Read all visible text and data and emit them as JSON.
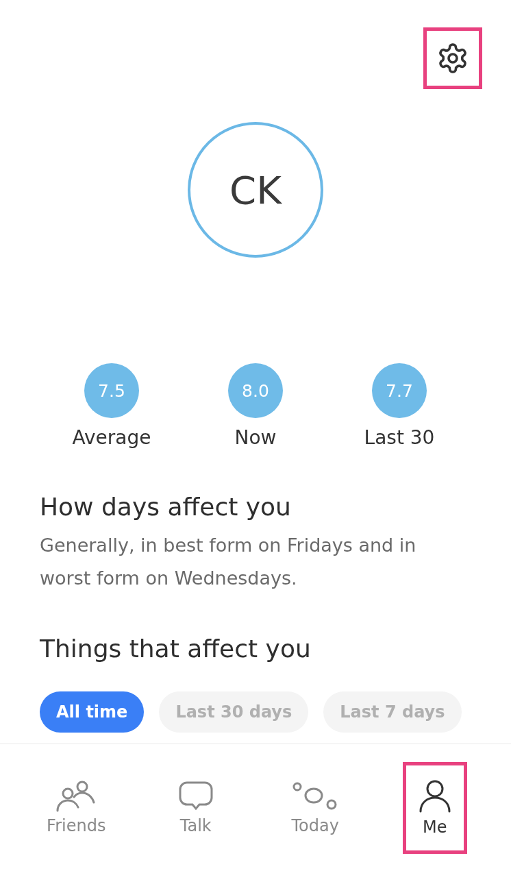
{
  "settings_button": {
    "highlighted": true
  },
  "avatar": {
    "initials": "CK"
  },
  "stats": [
    {
      "value": "7.5",
      "label": "Average"
    },
    {
      "value": "8.0",
      "label": "Now"
    },
    {
      "value": "7.7",
      "label": "Last 30"
    }
  ],
  "days_section": {
    "title": "How days affect you",
    "text": "Generally, in best form on Fridays and in worst form on Wednesdays."
  },
  "things_section": {
    "title": "Things that affect you",
    "filters": [
      {
        "label": "All time",
        "selected": true
      },
      {
        "label": "Last 30 days",
        "selected": false
      },
      {
        "label": "Last 7 days",
        "selected": false
      }
    ]
  },
  "nav": [
    {
      "kind": "friends",
      "label": "Friends",
      "selected": false,
      "highlighted": false
    },
    {
      "kind": "talk",
      "label": "Talk",
      "selected": false,
      "highlighted": false
    },
    {
      "kind": "today",
      "label": "Today",
      "selected": false,
      "highlighted": false
    },
    {
      "kind": "me",
      "label": "Me",
      "selected": true,
      "highlighted": true
    }
  ]
}
